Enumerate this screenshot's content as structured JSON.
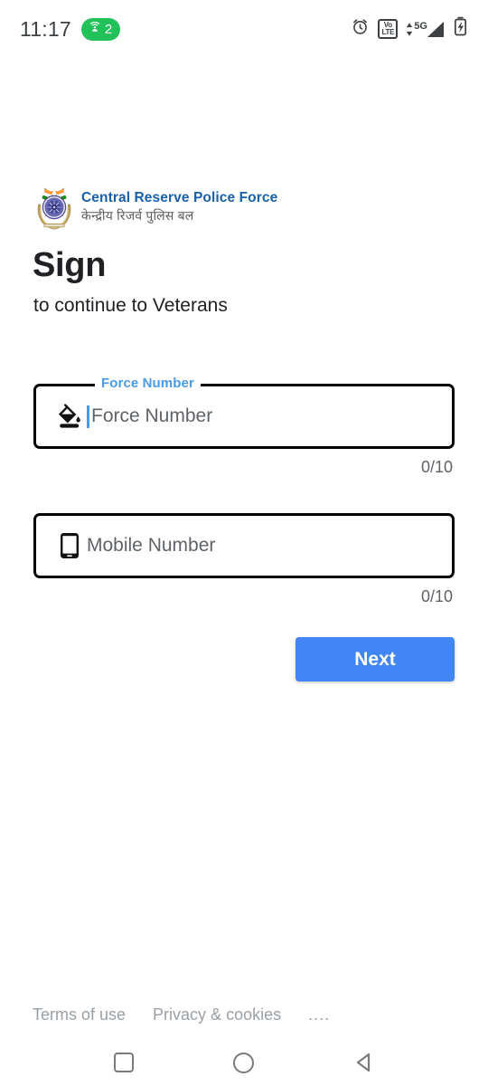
{
  "status_bar": {
    "time": "11:17",
    "hotspot_icon": "hotspot-icon",
    "hotspot_count": "2",
    "hotspot_color": "#21c25a",
    "alarm_icon": "alarm-clock-icon",
    "volte_line1": "Vo",
    "volte_line2": "LTE",
    "network_label": "5G",
    "signal_icon": "signal-bars-icon",
    "battery_icon": "battery-charging-icon"
  },
  "brand": {
    "emblem_icon": "crpf-emblem-icon",
    "name_en": "Central Reserve Police Force",
    "name_hi": "केन्द्रीय रिजर्व पुलिस बल",
    "accent_color": "#1a5fa8"
  },
  "page": {
    "title": "Sign",
    "subtitle": "to continue to Veterans"
  },
  "form": {
    "accent_color": "#4b9ae6",
    "fields": [
      {
        "label": "Force Number",
        "placeholder": "Force Number",
        "value": "",
        "counter": "0/10",
        "icon": "paint-bucket-icon",
        "focused": true
      },
      {
        "label": "",
        "placeholder": "Mobile Number",
        "value": "",
        "counter": "0/10",
        "icon": "smartphone-icon",
        "focused": false
      }
    ],
    "next_label": "Next",
    "next_color": "#4285f4"
  },
  "footer": {
    "terms_label": "Terms of use",
    "privacy_label": "Privacy & cookies",
    "more_label": "...."
  },
  "nav_bar": {
    "recents_icon": "recents-square-icon",
    "home_icon": "home-circle-icon",
    "back_icon": "back-triangle-icon"
  }
}
